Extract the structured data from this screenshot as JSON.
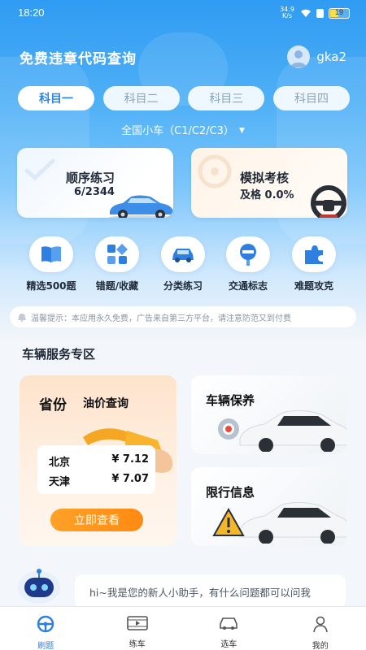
{
  "status": {
    "time": "18:20",
    "network_speed": "34.9 K/s",
    "battery": "19"
  },
  "header": {
    "title": "免费违章代码查询",
    "username": "gka2"
  },
  "subject_tabs": [
    "科目一",
    "科目二",
    "科目三",
    "科目四"
  ],
  "active_subject": "科目一",
  "car_type": "全国小车（C1/C2/C3）",
  "practice_cards": {
    "sequential": {
      "label": "顺序练习",
      "progress": "6/2344"
    },
    "mock_exam": {
      "label": "模拟考核",
      "pass_rate": "及格 0.0%"
    }
  },
  "quick_actions": [
    {
      "label": "精选500题",
      "icon": "book-icon"
    },
    {
      "label": "错题/收藏",
      "icon": "grid-icon"
    },
    {
      "label": "分类练习",
      "icon": "car-icon"
    },
    {
      "label": "交通标志",
      "icon": "sign-icon"
    },
    {
      "label": "难题攻克",
      "icon": "puzzle-icon"
    }
  ],
  "notice": "温馨提示：本应用永久免费，广告来自第三方平台，请注意防范又到付费",
  "services": {
    "section_title": "车辆服务专区",
    "oil": {
      "province_label": "省份",
      "title": "油价查询",
      "prices": [
        {
          "city": "北京",
          "price": "¥ 7.12"
        },
        {
          "city": "天津",
          "price": "¥ 7.07"
        }
      ],
      "button": "立即查看"
    },
    "maintenance": "车辆保养",
    "restriction": "限行信息"
  },
  "assistant_message": "hi~我是您的新人小助手，有什么问题都可以问我",
  "tabbar": [
    {
      "label": "刷题",
      "icon": "steering-wheel-icon"
    },
    {
      "label": "练车",
      "icon": "video-icon"
    },
    {
      "label": "选车",
      "icon": "car-outline-icon"
    },
    {
      "label": "我的",
      "icon": "person-icon"
    }
  ],
  "colors": {
    "primary": "#2f7fe0",
    "hero_top": "#2f9bf2",
    "accent_orange": "#ff8a12"
  }
}
